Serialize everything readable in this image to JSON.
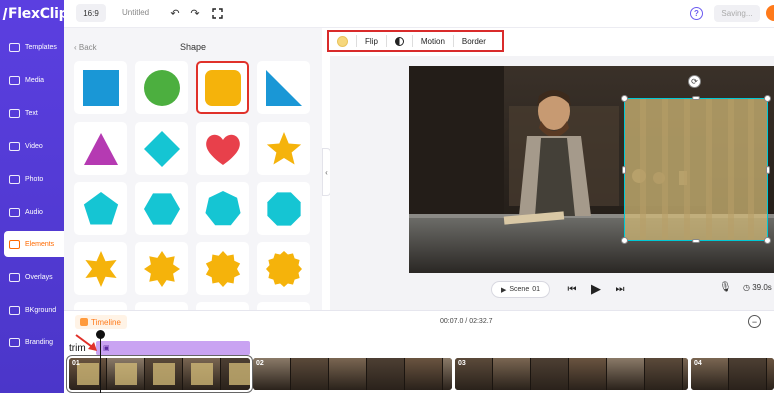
{
  "app": {
    "brand": "FlexClip"
  },
  "topbar": {
    "ratio": "16:9",
    "title": "Untitled",
    "saving": "Saving...",
    "help_label": "?"
  },
  "sidebar": {
    "items": [
      {
        "label": "Templates",
        "icon": "templates-icon"
      },
      {
        "label": "Media",
        "icon": "media-icon"
      },
      {
        "label": "Text",
        "icon": "text-icon"
      },
      {
        "label": "Video",
        "icon": "video-icon"
      },
      {
        "label": "Photo",
        "icon": "photo-icon"
      },
      {
        "label": "Audio",
        "icon": "audio-icon"
      },
      {
        "label": "Elements",
        "icon": "elements-icon",
        "active": true
      },
      {
        "label": "Overlays",
        "icon": "overlays-icon"
      },
      {
        "label": "BKground",
        "icon": "background-icon"
      },
      {
        "label": "Branding",
        "icon": "branding-icon"
      }
    ]
  },
  "panel": {
    "back": "Back",
    "title": "Shape",
    "shapes": [
      {
        "name": "square",
        "color": "#1a97d6"
      },
      {
        "name": "circle",
        "color": "#4caf3f"
      },
      {
        "name": "rounded-square",
        "color": "#f5b30b",
        "selected": true
      },
      {
        "name": "right-triangle",
        "color": "#1a97d6"
      },
      {
        "name": "triangle",
        "color": "#b53ab2"
      },
      {
        "name": "diamond",
        "color": "#15c5d3"
      },
      {
        "name": "heart",
        "color": "#e8404b"
      },
      {
        "name": "star-5",
        "color": "#f5b30b"
      },
      {
        "name": "pentagon",
        "color": "#15c5d3"
      },
      {
        "name": "hexagon",
        "color": "#15c5d3"
      },
      {
        "name": "heptagon",
        "color": "#15c5d3"
      },
      {
        "name": "octagon",
        "color": "#15c5d3"
      },
      {
        "name": "star-6",
        "color": "#f5b30b"
      },
      {
        "name": "star-8",
        "color": "#f5b30b"
      },
      {
        "name": "star-10",
        "color": "#f5b30b"
      },
      {
        "name": "star-12",
        "color": "#f5b30b"
      }
    ]
  },
  "toolbar": {
    "color_swatch": "#f6d77c",
    "flip": "Flip",
    "motion": "Motion",
    "border": "Border"
  },
  "player": {
    "scene": "Scene",
    "scene_number": "01",
    "duration": "39.0s"
  },
  "timeline": {
    "label": "Timeline",
    "time": "00:07.0 / 02:32.7",
    "trim": "trim",
    "clips": [
      "01",
      "02",
      "03",
      "04"
    ]
  },
  "colors": {
    "accent": "#ff6a00",
    "sidebar": "#5140d4",
    "highlight": "#d92b2b",
    "selection": "#00c9d6"
  }
}
